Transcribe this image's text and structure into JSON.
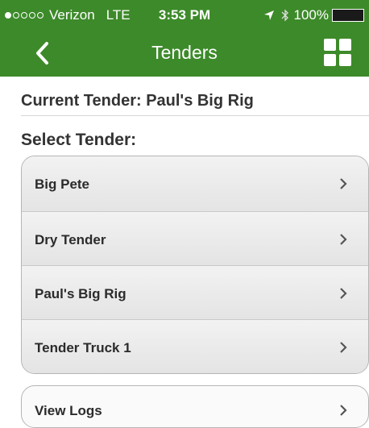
{
  "status_bar": {
    "carrier": "Verizon",
    "network": "LTE",
    "time": "3:53 PM",
    "battery": "100%"
  },
  "nav": {
    "title": "Tenders",
    "back_icon": "chevron-left-icon",
    "menu_icon": "grid-icon"
  },
  "current_tender": "Current Tender: Paul's Big Rig",
  "select_heading": "Select Tender:",
  "tenders": [
    {
      "label": "Big Pete"
    },
    {
      "label": "Dry Tender"
    },
    {
      "label": "Paul's Big Rig"
    },
    {
      "label": "Tender Truck 1"
    }
  ],
  "view_logs": "View Logs",
  "colors": {
    "header": "#3d8a2a",
    "text": "#2b2b2b"
  }
}
